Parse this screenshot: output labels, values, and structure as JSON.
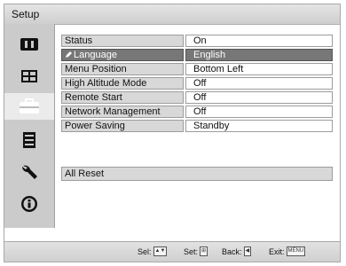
{
  "window": {
    "title": "Setup"
  },
  "sidebar": {
    "items": [
      {
        "icon": "picture-icon",
        "selected": false
      },
      {
        "icon": "screen-icon",
        "selected": false
      },
      {
        "icon": "setup-briefcase-icon",
        "selected": true
      },
      {
        "icon": "menu-list-icon",
        "selected": false
      },
      {
        "icon": "wrench-icon",
        "selected": false
      },
      {
        "icon": "info-icon",
        "selected": false
      }
    ]
  },
  "settings": [
    {
      "label": "Status",
      "value": "On"
    },
    {
      "label": "Language",
      "value": "English",
      "highlighted": true
    },
    {
      "label": "Menu Position",
      "value": "Bottom Left"
    },
    {
      "label": "High Altitude Mode",
      "value": "Off"
    },
    {
      "label": "Remote Start",
      "value": "Off"
    },
    {
      "label": "Network Management",
      "value": "Off"
    },
    {
      "label": "Power Saving",
      "value": "Standby"
    }
  ],
  "reset": {
    "label": "All Reset"
  },
  "footer": {
    "sel_label": "Sel:",
    "set_label": "Set:",
    "back_label": "Back:",
    "exit_label": "Exit:",
    "exit_key": "MENU"
  },
  "colors": {
    "highlight": "#777777",
    "label_bg": "#d8d8d8",
    "sidebar_bg": "#cbcbcb"
  }
}
